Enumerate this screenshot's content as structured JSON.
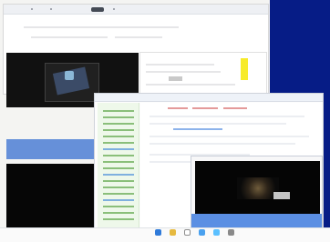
{
  "top_window": {
    "tab_count": 3
  },
  "colors": {
    "desktop_blue": "#061c86",
    "accent_blue": "#5b8fe3",
    "sidebar_green": "#8abf7a",
    "yellow": "#f7eb2a"
  },
  "icons": {
    "taskbar": [
      "browser-icon",
      "folder-icon",
      "mail-icon",
      "chat-icon",
      "media-icon",
      "settings-icon"
    ]
  }
}
